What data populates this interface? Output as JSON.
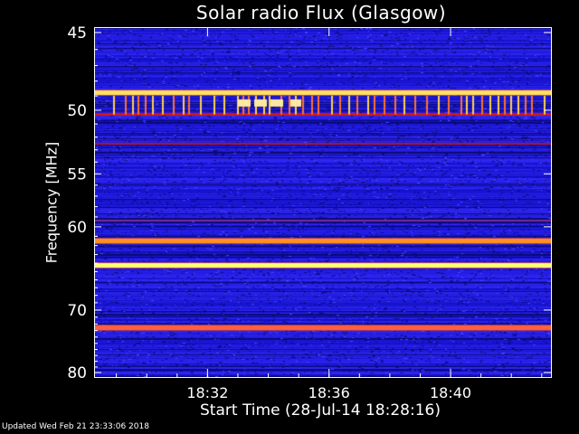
{
  "chart_data": {
    "type": "heatmap",
    "title": "Solar radio Flux (Glasgow)",
    "ylabel": "Frequency [MHz]",
    "xlabel": "Start Time (28-Jul-14 18:28:16)",
    "y_ticks": [
      45,
      50,
      55,
      60,
      70,
      80
    ],
    "ylim": [
      45,
      80
    ],
    "y_scale": "reciprocal",
    "x_ticks": [
      "18:32",
      "18:36",
      "18:40"
    ],
    "x_start": "18:28:16",
    "x_end": "18:43:20",
    "background_color": "#1a1ad0",
    "emission_lines": [
      {
        "freq_mhz": 48.8,
        "color": "#ffe060",
        "strength": "strong"
      },
      {
        "freq_mhz": 50.3,
        "color": "#d01818",
        "strength": "medium"
      },
      {
        "freq_mhz": 52.5,
        "color": "#b01818",
        "strength": "weak"
      },
      {
        "freq_mhz": 59.4,
        "color": "#7a2b9a",
        "strength": "weak"
      },
      {
        "freq_mhz": 61.5,
        "color": "#ff9020",
        "strength": "strong"
      },
      {
        "freq_mhz": 64.3,
        "color": "#ffff70",
        "strength": "strong"
      },
      {
        "freq_mhz": 72.6,
        "color": "#ff6040",
        "strength": "strong"
      }
    ],
    "grid": false
  },
  "footer_text": "Updated Wed Feb 21 23:33:06 2018"
}
